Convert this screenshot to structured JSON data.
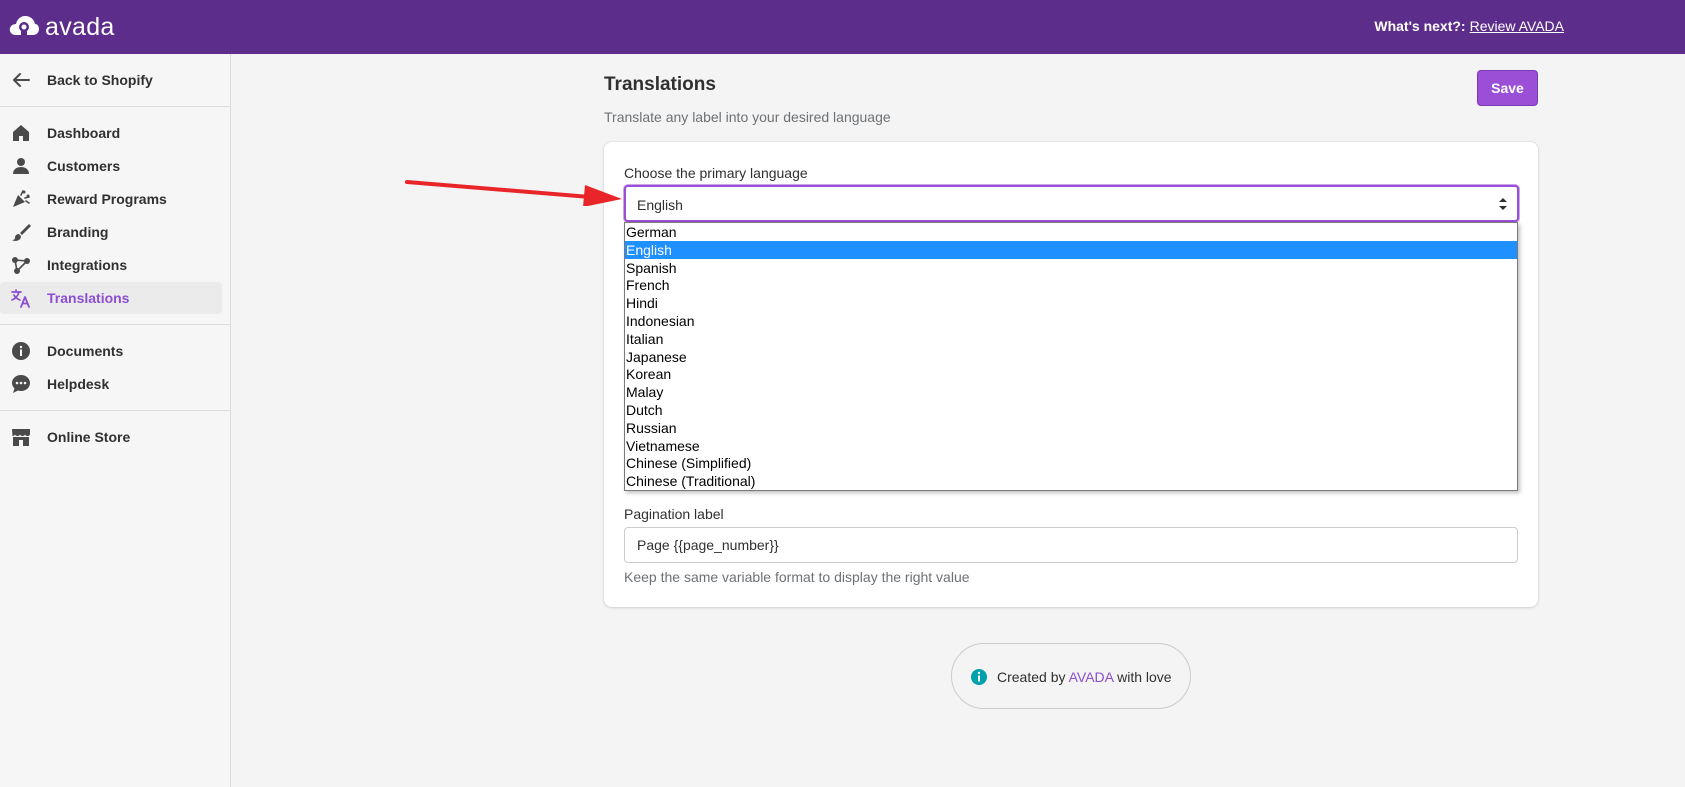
{
  "header": {
    "logo_text": "avada",
    "whats_next_label": "What's next?:",
    "review_link": "Review AVADA"
  },
  "sidebar": {
    "back": {
      "label": "Back to Shopify",
      "icon": "arrow-left-icon"
    },
    "items": [
      {
        "label": "Dashboard",
        "icon": "home-icon"
      },
      {
        "label": "Customers",
        "icon": "person-icon"
      },
      {
        "label": "Reward Programs",
        "icon": "confetti-icon"
      },
      {
        "label": "Branding",
        "icon": "brush-icon"
      },
      {
        "label": "Integrations",
        "icon": "network-icon"
      },
      {
        "label": "Translations",
        "icon": "translate-icon",
        "active": true
      }
    ],
    "secondary": [
      {
        "label": "Documents",
        "icon": "info-icon"
      },
      {
        "label": "Helpdesk",
        "icon": "chat-icon"
      }
    ],
    "tertiary": [
      {
        "label": "Online Store",
        "icon": "store-icon"
      }
    ]
  },
  "page": {
    "title": "Translations",
    "subtitle": "Translate any label into your desired language",
    "save_label": "Save"
  },
  "language_select": {
    "label": "Choose the primary language",
    "value": "English",
    "options": [
      "German",
      "English",
      "Spanish",
      "French",
      "Hindi",
      "Indonesian",
      "Italian",
      "Japanese",
      "Korean",
      "Malay",
      "Dutch",
      "Russian",
      "Vietnamese",
      "Chinese (Simplified)",
      "Chinese (Traditional)"
    ],
    "selected_index": 1
  },
  "pagination": {
    "label": "Pagination label",
    "value": "Page {{page_number}}",
    "help": "Keep the same variable format to display the right value"
  },
  "footer": {
    "prefix": "Created by",
    "brand": "AVADA",
    "suffix": "with love",
    "icon": "info-icon"
  },
  "colors": {
    "topbar": "#5c2d8a",
    "accent": "#9a4fd6",
    "active_nav": "#8b4fd1",
    "selected_option": "#1e90ff",
    "annotation_arrow": "#e8262a",
    "footer_icon": "#00a0ac"
  }
}
